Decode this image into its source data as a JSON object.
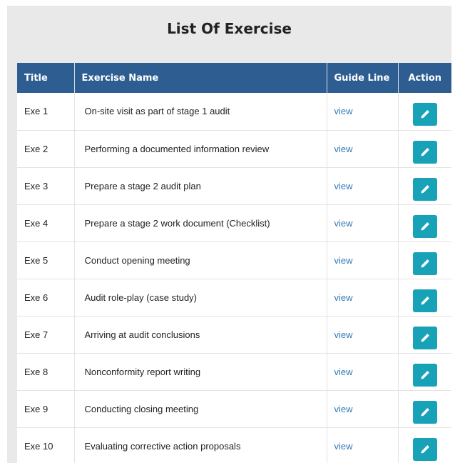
{
  "panel": {
    "title": "List Of Exercise"
  },
  "table": {
    "headers": {
      "title": "Title",
      "exercise_name": "Exercise Name",
      "guide_line": "Guide Line",
      "action": "Action"
    },
    "rows": [
      {
        "title": "Exe 1",
        "name": "On-site visit as part of stage 1 audit",
        "guide": "view",
        "action_icon": "pencil-icon"
      },
      {
        "title": "Exe 2",
        "name": "Performing a documented information review",
        "guide": "view",
        "action_icon": "pencil-icon"
      },
      {
        "title": "Exe 3",
        "name": "Prepare a stage 2 audit plan",
        "guide": "view",
        "action_icon": "pencil-icon"
      },
      {
        "title": "Exe 4",
        "name": "Prepare a stage 2 work document (Checklist)",
        "guide": "view",
        "action_icon": "pencil-icon"
      },
      {
        "title": "Exe 5",
        "name": "Conduct opening meeting",
        "guide": "view",
        "action_icon": "pencil-icon"
      },
      {
        "title": "Exe 6",
        "name": "Audit role-play (case study)",
        "guide": "view",
        "action_icon": "pencil-icon"
      },
      {
        "title": "Exe 7",
        "name": "Arriving at audit conclusions",
        "guide": "view",
        "action_icon": "pencil-icon"
      },
      {
        "title": "Exe 8",
        "name": "Nonconformity report writing",
        "guide": "view",
        "action_icon": "pencil-icon"
      },
      {
        "title": "Exe 9",
        "name": "Conducting closing meeting",
        "guide": "view",
        "action_icon": "pencil-icon"
      },
      {
        "title": "Exe 10",
        "name": "Evaluating corrective action proposals",
        "guide": "view",
        "action_icon": "pencil-icon"
      }
    ]
  },
  "colors": {
    "header_bg": "#2e5e91",
    "panel_bg": "#e9e9e9",
    "link": "#337ab7",
    "action_button": "#17a2b8"
  }
}
